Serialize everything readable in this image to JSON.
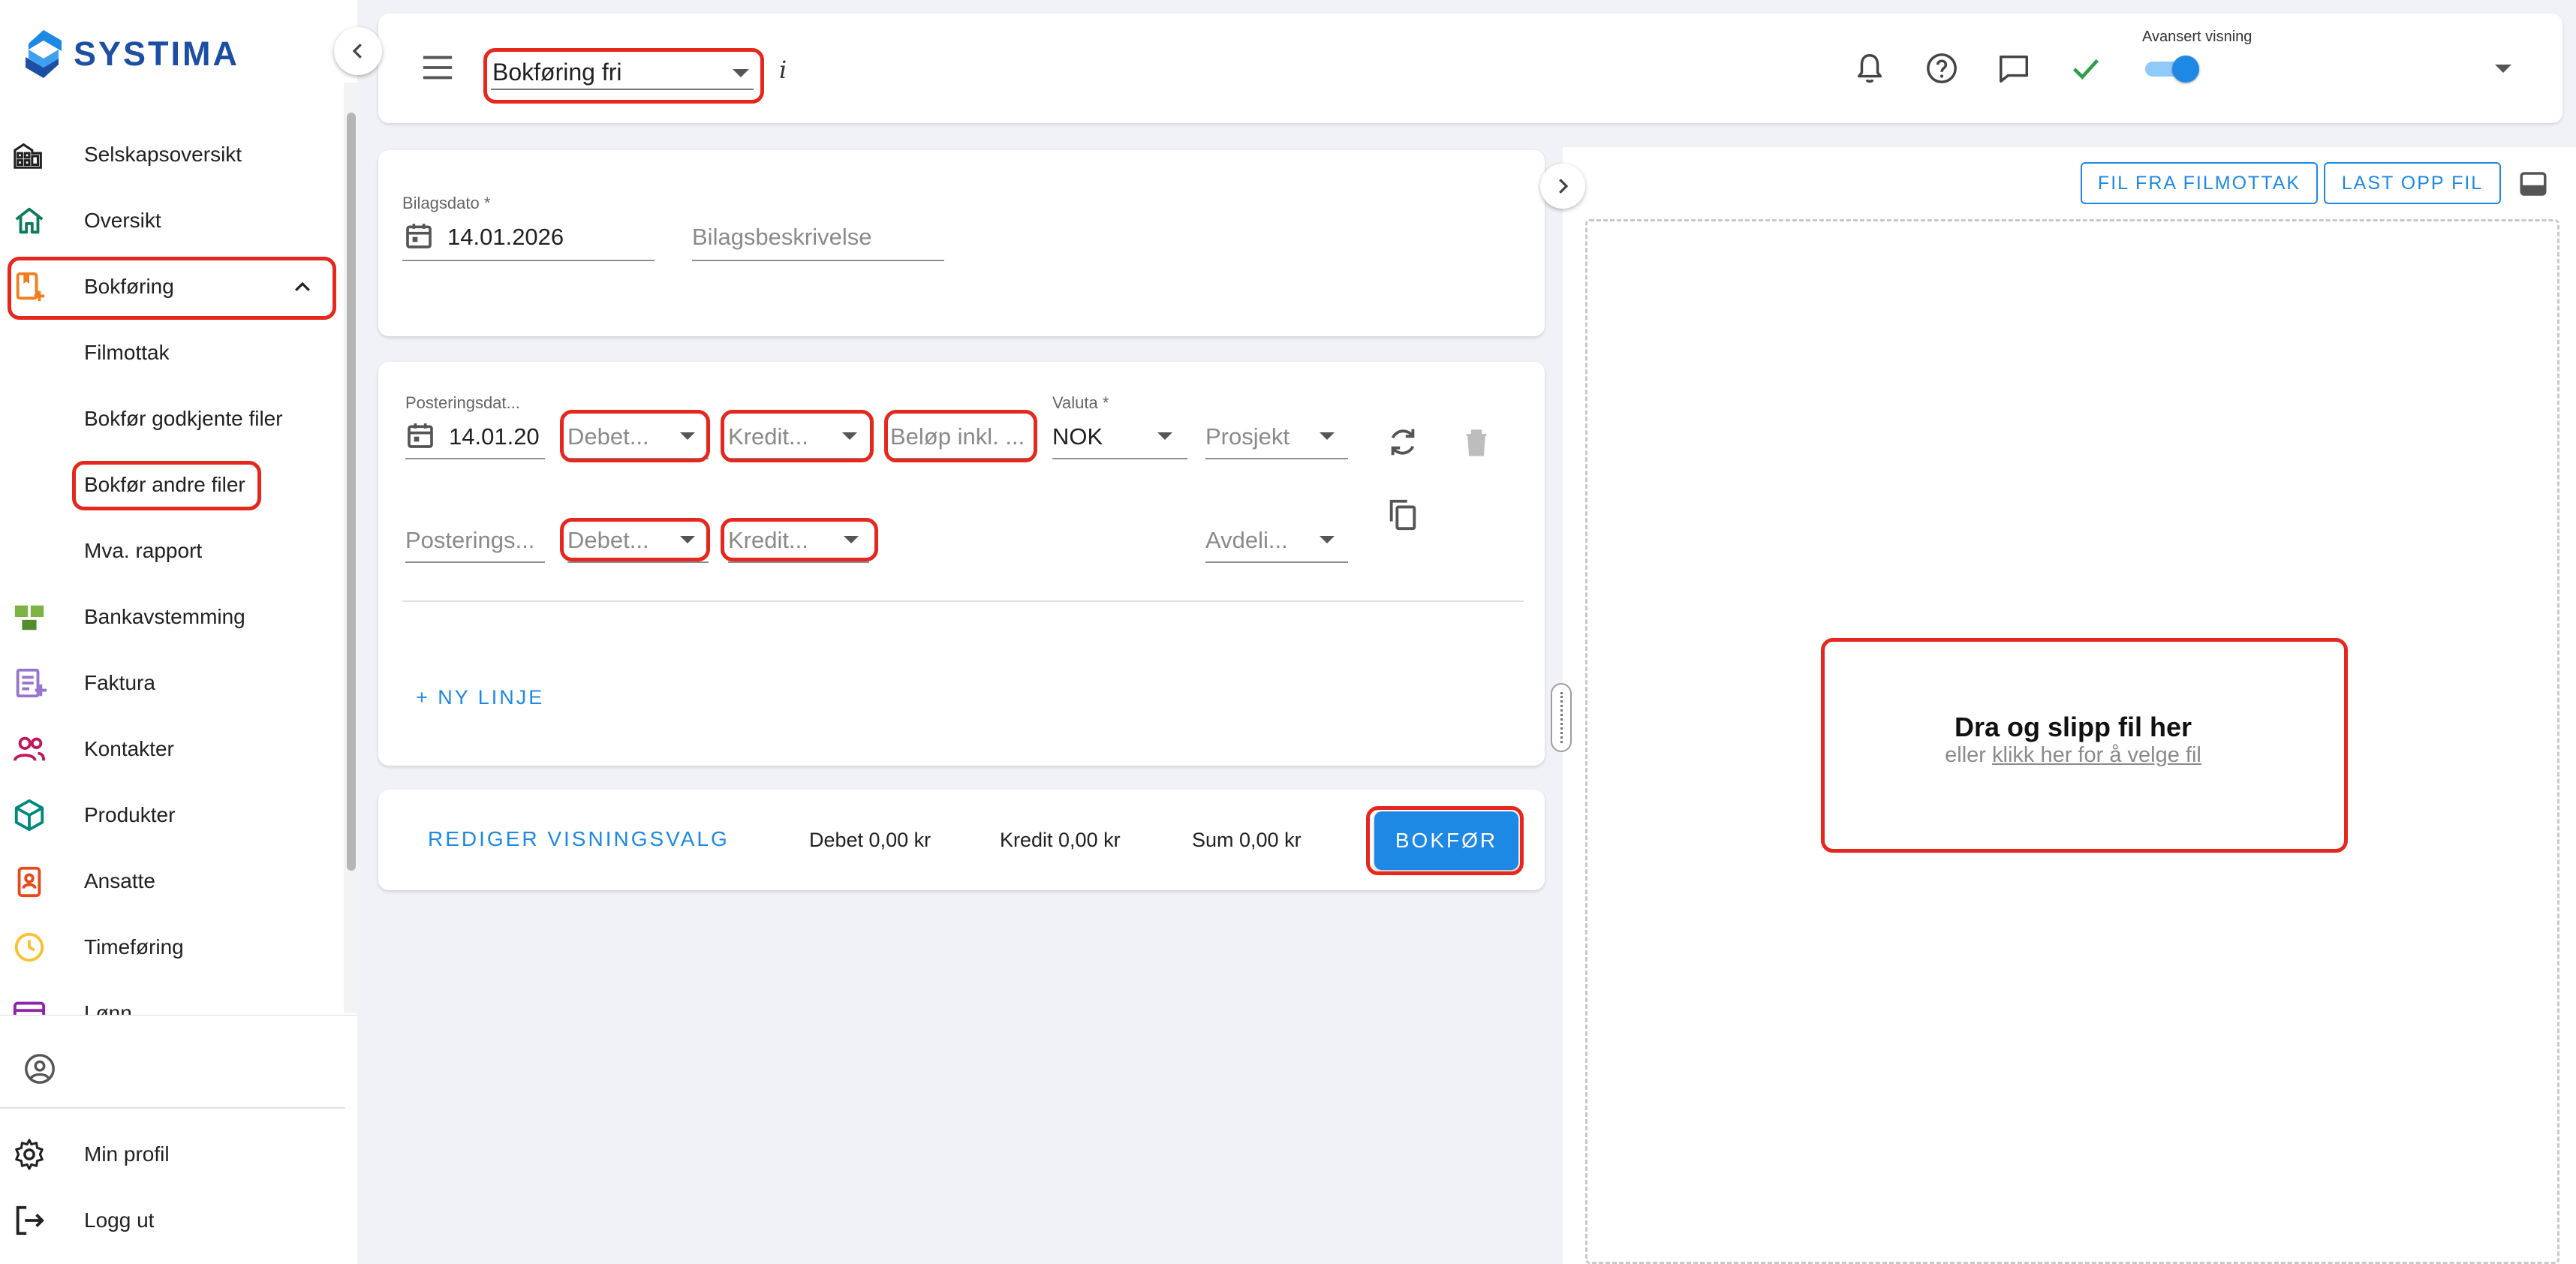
{
  "app": {
    "brand": "SYSTIMA"
  },
  "sidebar": {
    "items": [
      {
        "label": "Selskapsoversikt",
        "icon": "building-icon"
      },
      {
        "label": "Oversikt",
        "icon": "home-icon"
      },
      {
        "label": "Bokføring",
        "icon": "ledger-add-icon"
      },
      {
        "label": "Bankavstemming",
        "icon": "bank-reconcile-icon"
      },
      {
        "label": "Faktura",
        "icon": "invoice-icon"
      },
      {
        "label": "Kontakter",
        "icon": "contacts-icon"
      },
      {
        "label": "Produkter",
        "icon": "product-box-icon"
      },
      {
        "label": "Ansatte",
        "icon": "employee-badge-icon"
      },
      {
        "label": "Timeføring",
        "icon": "clock-icon"
      },
      {
        "label": "Lønn",
        "icon": "payroll-icon"
      }
    ],
    "subitems": [
      "Filmottak",
      "Bokfør godkjente filer",
      "Bokfør andre filer",
      "Mva. rapport"
    ],
    "bottom": {
      "profile": "Min profil",
      "logout": "Logg ut"
    }
  },
  "topbar": {
    "doc_type": "Bokføring fri",
    "info": "i",
    "advanced_label": "Avansert visning",
    "advanced_on": true
  },
  "header_form": {
    "date_label": "Bilagsdato *",
    "date_value": "14.01.2026",
    "description_placeholder": "Bilagsbeskrivelse"
  },
  "line": {
    "posting_date_label": "Posteringsdat...",
    "posting_date_value": "14.01.20",
    "debet_placeholder": "Debet...",
    "kredit_placeholder": "Kredit...",
    "amount_placeholder": "Beløp inkl. ...",
    "currency_label": "Valuta *",
    "currency_value": "NOK",
    "project_placeholder": "Prosjekt",
    "posting_text_placeholder": "Posterings...",
    "debet2_placeholder": "Debet...",
    "kredit2_placeholder": "Kredit...",
    "department_placeholder": "Avdeli...",
    "new_line": "+ NY LINJE"
  },
  "footer": {
    "edit_view": "REDIGER VISNINGSVALG",
    "debet_total": "Debet 0,00 kr",
    "kredit_total": "Kredit 0,00 kr",
    "sum_total": "Sum 0,00 kr",
    "book": "BOKFØR"
  },
  "file_panel": {
    "from_inbox": "FIL FRA FILMOTTAK",
    "upload": "LAST OPP FIL",
    "drop_title": "Dra og slipp fil her",
    "drop_prefix": "eller ",
    "drop_link": "klikk her for å velge fil"
  },
  "colors": {
    "accent": "#1e88e5",
    "brand": "#1c4fa3",
    "highlight": "#e5271d"
  }
}
